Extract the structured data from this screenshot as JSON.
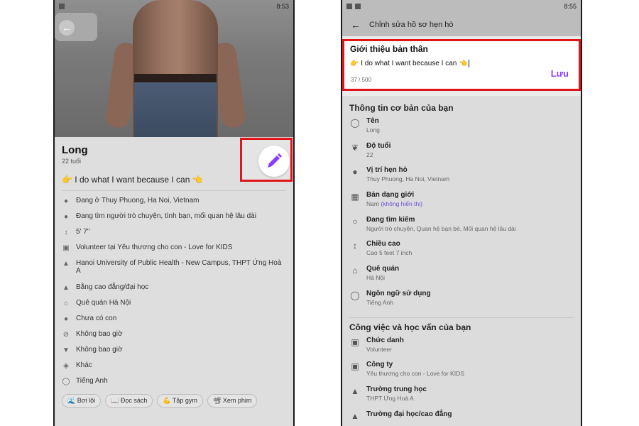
{
  "left": {
    "status_time": "8:53",
    "name": "Long",
    "age": "22 tuổi",
    "bio": "👉 I do what I want because I can 👈",
    "info": [
      {
        "icon": "location-pin-icon",
        "text": "Đang ở Thuy Phuong, Ha Noi, Vietnam"
      },
      {
        "icon": "chat-bubbles-icon",
        "text": "Đang tìm người trò chuyện, tình bạn, mối quan hệ lâu dài"
      },
      {
        "icon": "height-icon",
        "text": "5' 7\""
      },
      {
        "icon": "briefcase-icon",
        "text": "Volunteer tại Yêu thương cho con - Love for KIDS"
      },
      {
        "icon": "graduation-cap-icon",
        "text": "Hanoi University of Public Health - New Campus, THPT Ứng Hoà A"
      },
      {
        "icon": "graduation-cap-icon",
        "text": "Bằng cao đẳng/đại học"
      },
      {
        "icon": "home-icon",
        "text": "Quê quán Hà Nội"
      },
      {
        "icon": "children-icon",
        "text": "Chưa có con"
      },
      {
        "icon": "no-smoking-icon",
        "text": "Không bao giờ"
      },
      {
        "icon": "cocktail-icon",
        "text": "Không bao giờ"
      },
      {
        "icon": "prayer-icon",
        "text": "Khác"
      },
      {
        "icon": "globe-icon",
        "text": "Tiếng Anh"
      }
    ],
    "chips": [
      "🌊 Bơi lội",
      "📖 Đọc sách",
      "💪 Tập gym",
      "📽 Xem phim"
    ]
  },
  "right": {
    "status_time": "8:55",
    "header_title": "Chỉnh sửa hồ sơ hẹn hò",
    "intro": {
      "title": "Giới thiệu bản thân",
      "text": "👉 I do what I want because I can 👈",
      "count": "37 / 500",
      "save": "Lưu"
    },
    "basic_title": "Thông tin cơ bản của bạn",
    "basic_fields": [
      {
        "icon": "person-icon",
        "label": "Tên",
        "value": "Long"
      },
      {
        "icon": "leaf-icon",
        "label": "Độ tuổi",
        "value": "22"
      },
      {
        "icon": "location-pin-icon",
        "label": "Vị trí hẹn hò",
        "value": "Thuy Phuong, Ha Noi, Vietnam"
      },
      {
        "icon": "gender-icon",
        "label": "Bản dạng giới",
        "value": "Nam",
        "value_extra": "(không hiển thị)"
      },
      {
        "icon": "chat-bubbles-icon",
        "label": "Đang tìm kiếm",
        "value": "Người trò chuyện, Quan hệ bạn bè, Mối quan hệ lâu dài"
      },
      {
        "icon": "height-icon",
        "label": "Chiều cao",
        "value": "Cao 5 feet 7 inch"
      },
      {
        "icon": "home-icon",
        "label": "Quê quán",
        "value": "Hà Nội"
      },
      {
        "icon": "globe-icon",
        "label": "Ngôn ngữ sử dụng",
        "value": "Tiếng Anh"
      }
    ],
    "work_title": "Công việc và học vấn của bạn",
    "work_fields": [
      {
        "icon": "briefcase-icon",
        "label": "Chức danh",
        "value": "Volunteer"
      },
      {
        "icon": "briefcase-icon",
        "label": "Công ty",
        "value": "Yêu thương cho con - Love for KIDS"
      },
      {
        "icon": "graduation-cap-icon",
        "label": "Trường trung học",
        "value": "THPT Ứng Hoà A"
      },
      {
        "icon": "graduation-cap-icon",
        "label": "Trường đại học/cao đẳng",
        "value": ""
      }
    ]
  },
  "colors": {
    "highlight": "#e1141c",
    "accent": "#8b3dff",
    "link": "#6d4ed8"
  }
}
